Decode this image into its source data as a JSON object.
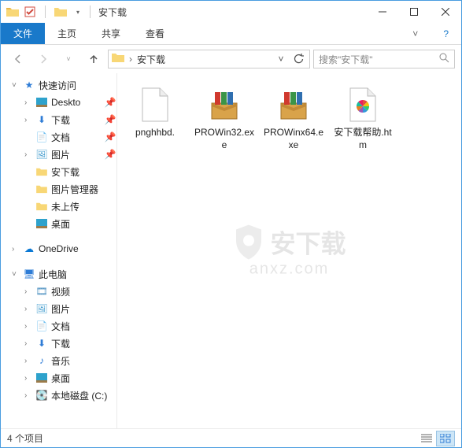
{
  "window": {
    "title": "安下载"
  },
  "ribbon": {
    "file": "文件",
    "tabs": [
      "主页",
      "共享",
      "查看"
    ]
  },
  "breadcrumb": {
    "current": "安下载"
  },
  "search": {
    "placeholder": "搜索\"安下载\""
  },
  "sidebar": {
    "quick_access": "快速访问",
    "quick_items": [
      "Deskto",
      "下载",
      "文档",
      "图片",
      "安下载",
      "图片管理器",
      "未上传",
      "桌面"
    ],
    "onedrive": "OneDrive",
    "this_pc": "此电脑",
    "pc_items": [
      "视频",
      "图片",
      "文档",
      "下载",
      "音乐",
      "桌面",
      "本地磁盘 (C:)"
    ]
  },
  "files": [
    {
      "name": "pnghhbd.",
      "type": "blank"
    },
    {
      "name": "PROWin32.exe",
      "type": "installer"
    },
    {
      "name": "PROWinx64.exe",
      "type": "installer"
    },
    {
      "name": "安下载帮助.htm",
      "type": "htm"
    }
  ],
  "status": {
    "count": "4 个项目"
  },
  "watermark": {
    "text": "安下载",
    "sub": "anxz.com"
  }
}
